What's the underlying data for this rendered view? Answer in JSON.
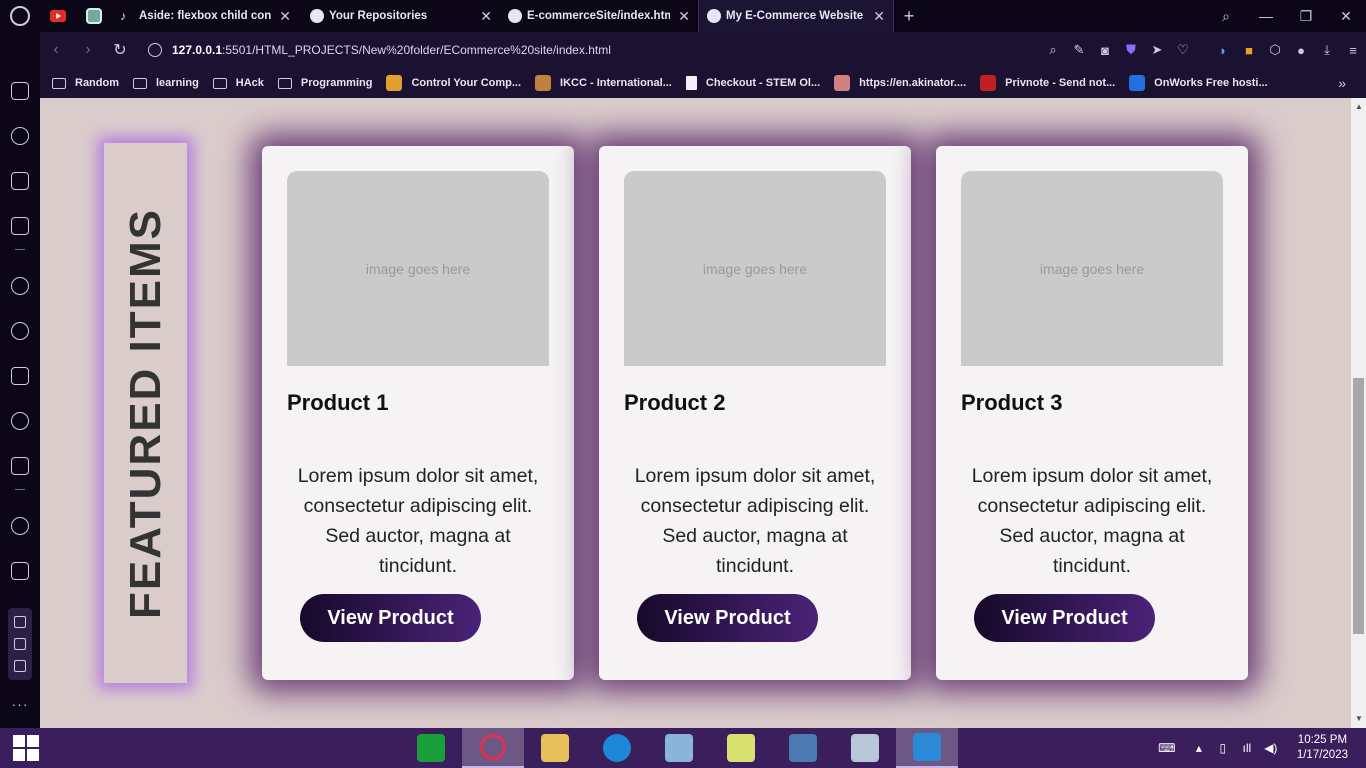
{
  "browser": {
    "pinned": [
      {
        "name": "youtube",
        "icon": "youtube-icon"
      },
      {
        "name": "chatgpt",
        "icon": "chatgpt-icon"
      }
    ],
    "tabs": [
      {
        "title": "Aside: flexbox child con",
        "icon": "audio-playing-icon",
        "active": false
      },
      {
        "title": "Your Repositories",
        "icon": "github-icon",
        "active": false
      },
      {
        "title": "E-commerceSite/index.html",
        "icon": "github-icon",
        "active": false
      },
      {
        "title": "My E-Commerce Website",
        "icon": "globe-icon",
        "active": true
      }
    ],
    "url_host": "127.0.0.1",
    "url_path": ":5501/HTML_PROJECTS/New%20folder/ECommerce%20site/index.html",
    "bookmarks": [
      {
        "label": "Random",
        "icon": "folder-icon"
      },
      {
        "label": "learning",
        "icon": "folder-icon"
      },
      {
        "label": "HAck",
        "icon": "folder-icon"
      },
      {
        "label": "Programming",
        "icon": "folder-icon"
      },
      {
        "label": "Control Your Comp...",
        "icon": "site-icon"
      },
      {
        "label": "IKCC - International...",
        "icon": "site-icon"
      },
      {
        "label": "Checkout - STEM Ol...",
        "icon": "document-icon"
      },
      {
        "label": "https://en.akinator....",
        "icon": "site-icon"
      },
      {
        "label": "Privnote - Send not...",
        "icon": "site-icon"
      },
      {
        "label": "OnWorks Free hosti...",
        "icon": "site-icon"
      }
    ]
  },
  "page": {
    "featured_label": "FEATURED ITEMS",
    "products": [
      {
        "image_text": "image goes here",
        "name": "Product 1",
        "description": "Lorem ipsum dolor sit amet, consectetur adipiscing elit. Sed auctor, magna at tincidunt.",
        "button": "View Product"
      },
      {
        "image_text": "image goes here",
        "name": "Product 2",
        "description": "Lorem ipsum dolor sit amet, consectetur adipiscing elit. Sed auctor, magna at tincidunt.",
        "button": "View Product"
      },
      {
        "image_text": "image goes here",
        "name": "Product 3",
        "description": "Lorem ipsum dolor sit amet, consectetur adipiscing elit. Sed auctor, magna at tincidunt.",
        "button": "View Product"
      }
    ]
  },
  "taskbar": {
    "time": "10:25 PM",
    "date": "1/17/2023"
  },
  "colors": {
    "page_background": "#dbcccc",
    "card_shadow": "#4b195f",
    "featured_glow": "#a564e6",
    "button_gradient_start": "#17092a",
    "button_gradient_end": "#4a2378",
    "taskbar": "#3b1f5c"
  }
}
